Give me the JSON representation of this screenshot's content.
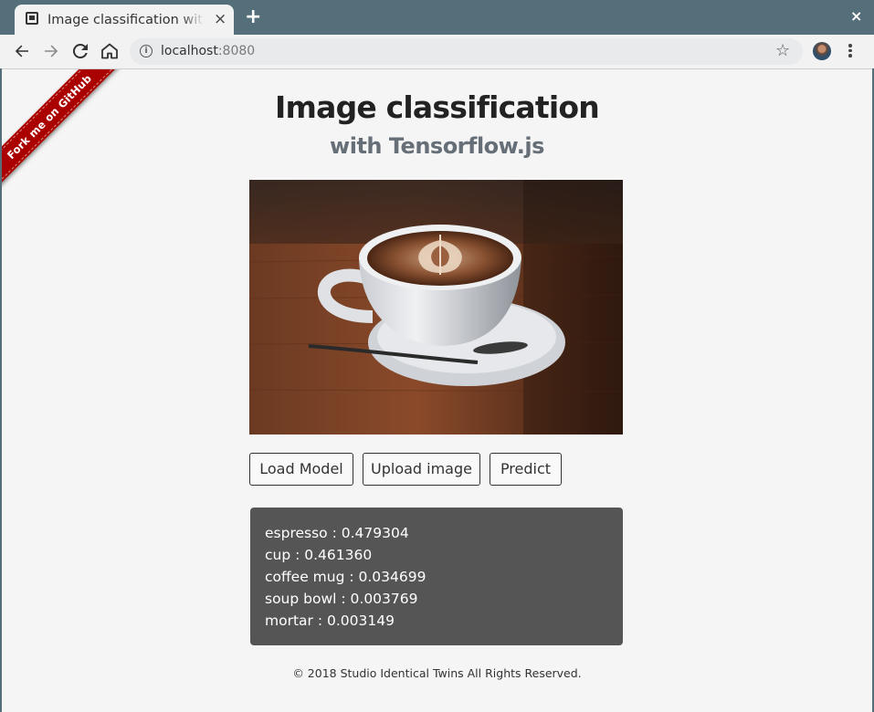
{
  "browser": {
    "tab_title": "Image classification with Tensorflow.js",
    "tab_close": "×",
    "new_tab": "+",
    "window_close": "×",
    "url_host": "localhost",
    "url_port": ":8080"
  },
  "ribbon": {
    "label": "Fork me on GitHub"
  },
  "header": {
    "title": "Image classification",
    "subtitle": "with Tensorflow.js"
  },
  "buttons": {
    "load_model": "Load Model",
    "upload_image": "Upload image",
    "predict": "Predict"
  },
  "predictions": [
    {
      "text": "espresso : 0.479304"
    },
    {
      "text": "cup : 0.461360"
    },
    {
      "text": "coffee mug : 0.034699"
    },
    {
      "text": "soup bowl : 0.003769"
    },
    {
      "text": "mortar : 0.003149"
    }
  ],
  "footer": {
    "text": "© 2018 Studio Identical Twins All Rights Reserved."
  },
  "colors": {
    "chrome": "#546f7a",
    "ribbon": "#aa0000",
    "results_bg": "#555555",
    "subtitle": "#666f78"
  }
}
